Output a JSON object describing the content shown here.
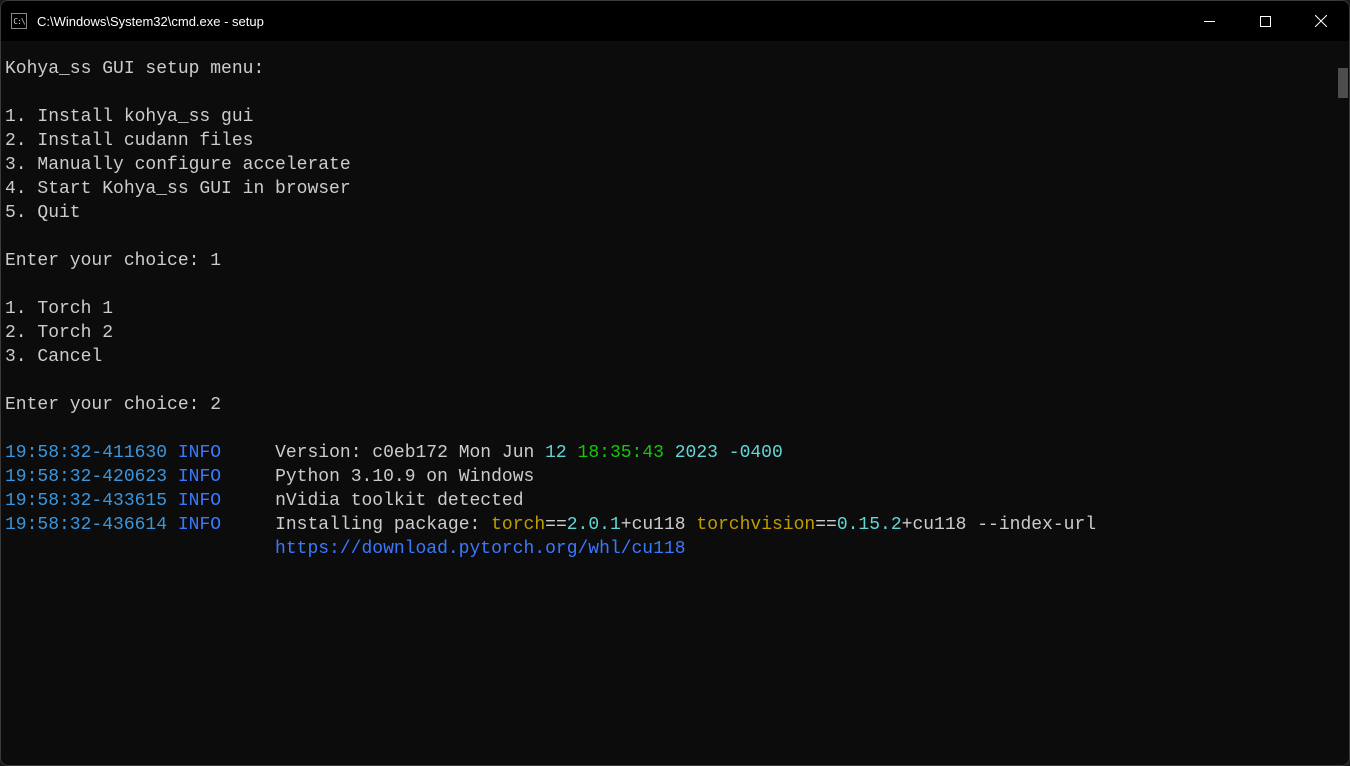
{
  "window": {
    "title": "C:\\Windows\\System32\\cmd.exe - setup",
    "icon_label": "C:\\"
  },
  "menu": {
    "header": "Kohya_ss GUI setup menu:",
    "options": [
      "1. Install kohya_ss gui",
      "2. Install cudann files",
      "3. Manually configure accelerate",
      "4. Start Kohya_ss GUI in browser",
      "5. Quit"
    ],
    "prompt1": "Enter your choice: 1",
    "submenu": [
      "1. Torch 1",
      "2. Torch 2",
      "3. Cancel"
    ],
    "prompt2": "Enter your choice: 2"
  },
  "log": {
    "l1": {
      "ts": "19:58:32-411630",
      "lvl": "INFO",
      "pre": "Version: c0eb172 Mon Jun ",
      "day": "12",
      "time": " 18:35:43",
      "year": " 2023",
      "tz": " -0400"
    },
    "l2": {
      "ts": "19:58:32-420623",
      "lvl": "INFO",
      "msg": "Python 3.10.9 on Windows"
    },
    "l3": {
      "ts": "19:58:32-433615",
      "lvl": "INFO",
      "msg": "nVidia toolkit detected"
    },
    "l4": {
      "ts": "19:58:32-436614",
      "lvl": "INFO",
      "pre": "Installing package: ",
      "pkg1": "torch",
      "eq1": "==",
      "v1": "2.0.1",
      "post1": "+cu118 ",
      "pkg2": "torchvision",
      "eq2": "==",
      "v2": "0.15.2",
      "post2": "+cu118 --index-url",
      "url": "https://download.pytorch.org/whl/cu118"
    },
    "pad": "                         "
  }
}
